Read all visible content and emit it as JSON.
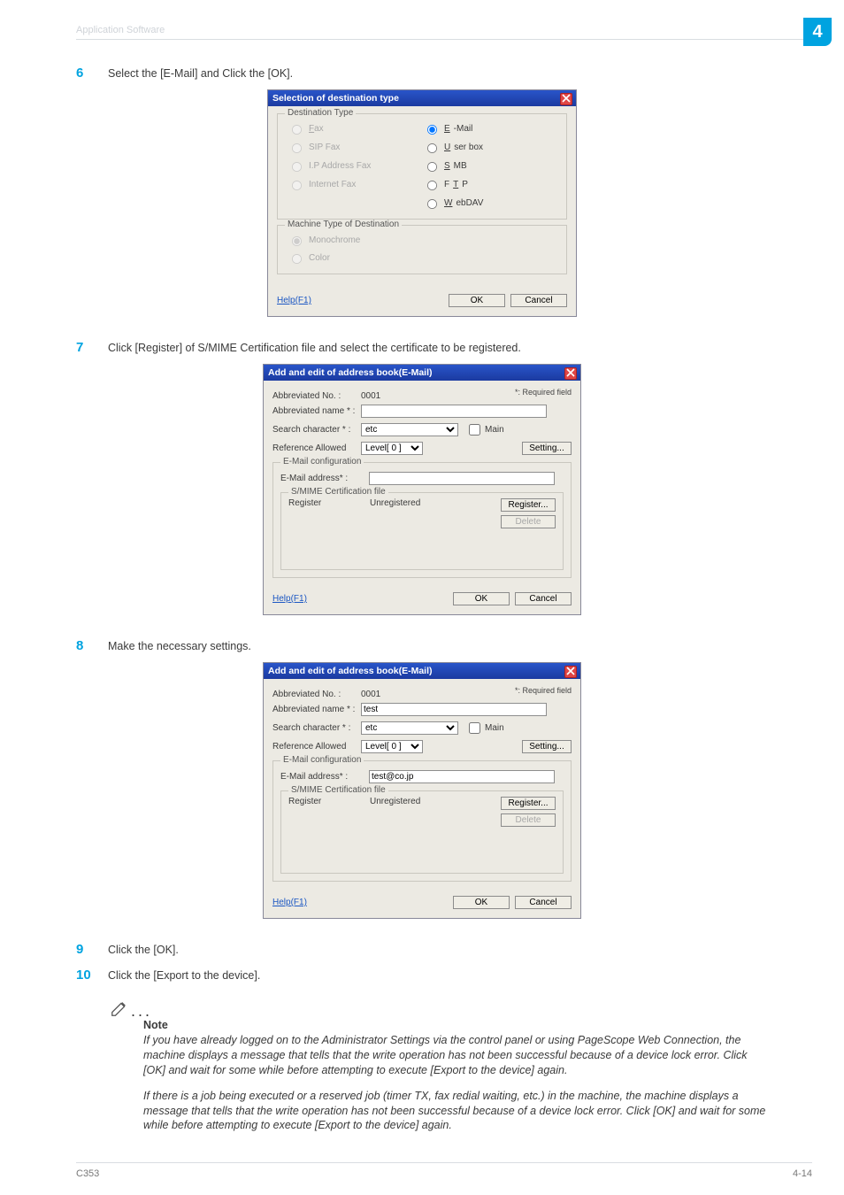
{
  "page": {
    "header_title": "Application Software",
    "corner_number": "4",
    "footer_left": "C353",
    "footer_right": "4-14"
  },
  "steps": {
    "s6": {
      "num": "6",
      "text": "Select the [E-Mail] and Click the [OK]."
    },
    "s7": {
      "num": "7",
      "text": "Click [Register] of S/MIME Certification file and select the certificate to be registered."
    },
    "s8": {
      "num": "8",
      "text": "Make the necessary settings."
    },
    "s9": {
      "num": "9",
      "text": "Click the [OK]."
    },
    "s10": {
      "num": "10",
      "text": "Click the [Export to the device]."
    }
  },
  "dlg_sel": {
    "title": "Selection of destination type",
    "grp1_title": "Destination Type",
    "grp2_title": "Machine Type of Destination",
    "opts": {
      "fax": "Fax",
      "sip": "SIP Fax",
      "ip": "I.P Address Fax",
      "internet": "Internet Fax",
      "email": "E-Mail",
      "userbox": "User box",
      "smb": "SMB",
      "ftp": "FTP",
      "webdav": "WebDAV",
      "mono": "Monochrome",
      "color": "Color"
    },
    "help": "Help(F1)",
    "ok": "OK",
    "cancel": "Cancel"
  },
  "dlg_mail_a": {
    "title": "Add and edit of address book(E-Mail)",
    "required": "*: Required field",
    "labels": {
      "abbr_no": "Abbreviated No. :",
      "abbr_name": "Abbreviated name * :",
      "search": "Search character * :",
      "ref": "Reference Allowed",
      "conf_title": "E-Mail configuration",
      "email_addr": "E-Mail address* :",
      "smime_title": "S/MIME Certification file",
      "register": "Register"
    },
    "values": {
      "abbr_no": "0001",
      "abbr_name": "",
      "search": "etc",
      "ref_level": "Level[ 0 ]",
      "main": "Main",
      "setting": "Setting...",
      "email": "",
      "reg_state": "Unregistered",
      "register_btn": "Register...",
      "delete_btn": "Delete"
    },
    "help": "Help(F1)",
    "ok": "OK",
    "cancel": "Cancel"
  },
  "dlg_mail_b": {
    "title": "Add and edit of address book(E-Mail)",
    "required": "*: Required field",
    "values": {
      "abbr_no": "0001",
      "abbr_name": "test",
      "search": "etc",
      "ref_level": "Level[ 0 ]",
      "email": "test@co.jp",
      "reg_state": "Unregistered"
    }
  },
  "notes": {
    "head": "Note",
    "p1": "If you have already logged on to the Administrator Settings via the control panel or using PageScope Web Connection, the machine displays a message that tells that the write operation has not been successful because of a device lock error. Click [OK] and wait for some while before attempting to execute [Export to the device] again.",
    "p2": "If there is a job being executed or a reserved job (timer TX, fax redial waiting, etc.) in the machine, the machine displays a message that tells that the write operation has not been successful because of a device lock error. Click [OK] and wait for some while before attempting to execute [Export to the device] again."
  }
}
